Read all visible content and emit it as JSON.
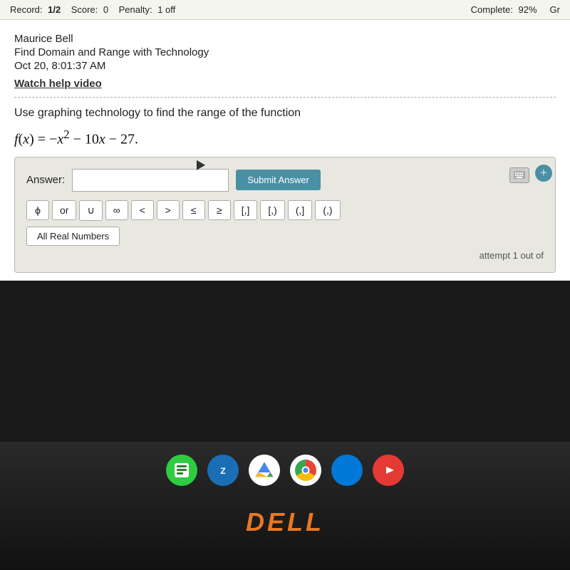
{
  "topbar": {
    "record_label": "Record:",
    "record_value": "1/2",
    "score_label": "Score:",
    "score_value": "0",
    "penalty_label": "Penalty:",
    "penalty_value": "1 off",
    "complete_label": "Complete:",
    "complete_value": "92%",
    "grade_label": "Gr"
  },
  "student": {
    "name": "Maurice Bell",
    "assignment": "Find Domain and Range with Technology",
    "datetime": "Oct 20, 8:01:37 AM",
    "watch_help": "Watch help video"
  },
  "problem": {
    "instructions": "Use graphing technology to find the range of the function",
    "function_text": "f(x) = −x² − 10x − 27."
  },
  "answer": {
    "label": "Answer:",
    "input_value": "",
    "submit_label": "Submit Answer"
  },
  "symbols": [
    {
      "id": "phi",
      "label": "ϕ"
    },
    {
      "id": "or",
      "label": "or"
    },
    {
      "id": "union",
      "label": "∪"
    },
    {
      "id": "infinity",
      "label": "∞"
    },
    {
      "id": "less",
      "label": "<"
    },
    {
      "id": "greater",
      "label": ">"
    },
    {
      "id": "leq",
      "label": "≤"
    },
    {
      "id": "geq",
      "label": "≥"
    },
    {
      "id": "bracket-open",
      "label": "[,]"
    },
    {
      "id": "paren-open-bracket-close",
      "label": "[,)"
    },
    {
      "id": "bracket-open-paren-close",
      "label": "(,]"
    },
    {
      "id": "paren-open",
      "label": "(,)"
    }
  ],
  "all_real_numbers": "All Real Numbers",
  "attempt_text": "attempt 1 out of",
  "dell_logo": "DELL"
}
